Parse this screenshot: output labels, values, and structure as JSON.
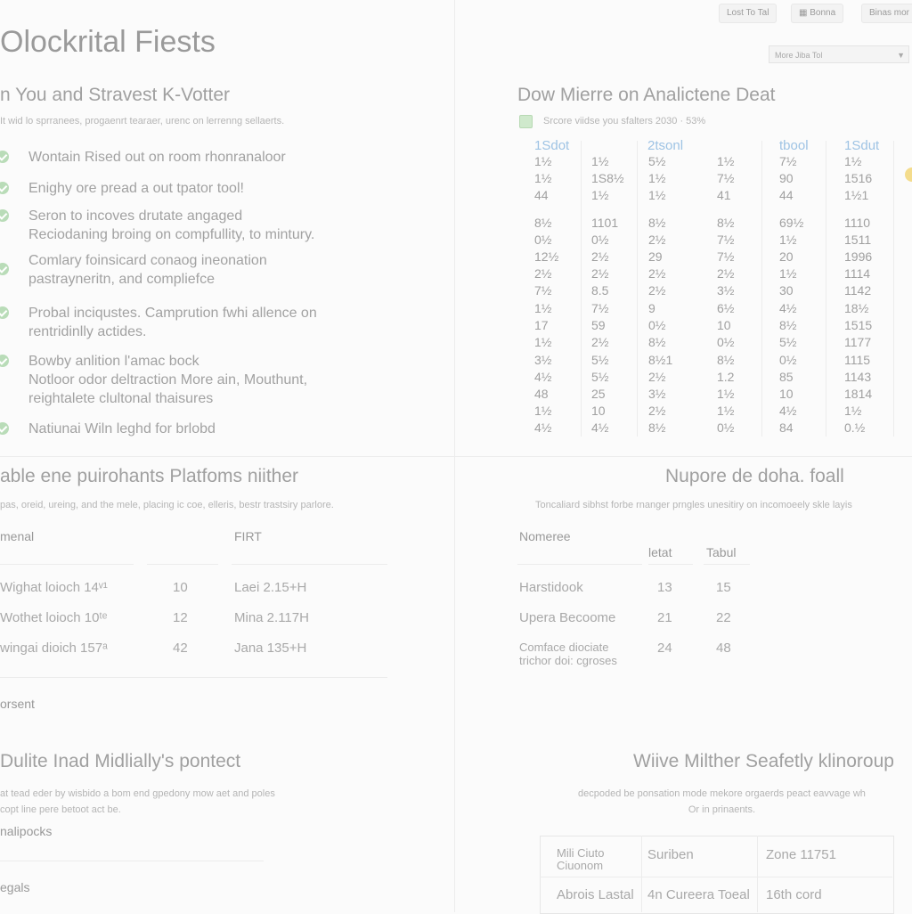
{
  "topbar": {
    "buttons": [
      "Lost To Tal",
      "Bonna",
      "Binas mor"
    ],
    "select_value": "More Jiba Tol"
  },
  "page_title": "Olockrital Fiests",
  "checklist_panel": {
    "title": "n You and Stravest K-Votter",
    "subtitle": "It wid lo sprranees, progaenrt tearaer, urenc on lerrenng sellaerts.",
    "items": [
      "Wontain Rised out on room rhonranaloor",
      "Enighy ore pread a out tpator tool!",
      "Seron to incoves drutate angaged\nReciodaning broing on compfullity, to mintury.",
      "Comlary foinsicard conaog ineonation\npastrayneritn, and compliefce",
      "Probal inciqustes. Camprution fwhi allence on\nrentridinlly actides.",
      "Bowby anlition l'amac bock\nNotloor odor deltraction More ain, Mouthunt,\nreightalete clultonal thaisures",
      "Natiunai Wiln leghd for brlobd"
    ]
  },
  "grid_panel": {
    "title": "Dow Mierre on Analictene Deat",
    "checkbox_label": "Srcore viidse you sfalters  2030 · 53%",
    "columns": [
      "1Sdot",
      "2tsonl",
      "tbool",
      "1Sdut"
    ],
    "rows": [
      [
        "1½",
        "1½",
        "5½",
        "1½",
        "7½",
        "1½"
      ],
      [
        "1½",
        "1S8½",
        "1½",
        "7½",
        "90",
        "1516"
      ],
      [
        "44",
        "1½",
        "1½",
        "41",
        "44",
        "1½1"
      ],
      [
        "8½",
        "1101",
        "8½",
        "8½",
        "69½",
        "1110"
      ],
      [
        "0½",
        "0½",
        "2½",
        "7½",
        "1½",
        "1511"
      ],
      [
        "12½",
        "2½",
        "29",
        "7½",
        "20",
        "1996"
      ],
      [
        "2½",
        "2½",
        "2½",
        "2½",
        "1½",
        "1114"
      ],
      [
        "7½",
        "8.5",
        "2½",
        "3½",
        "30",
        "1142"
      ],
      [
        "1½",
        "7½",
        "9",
        "6½",
        "4½",
        "18½"
      ],
      [
        "17",
        "59",
        "0½",
        "10",
        "8½",
        "1515"
      ],
      [
        "1½",
        "2½",
        "8½",
        "0½",
        "5½",
        "1177"
      ],
      [
        "3½",
        "5½",
        "8½1",
        "8½",
        "0½",
        "1115"
      ],
      [
        "4½",
        "5½",
        "2½",
        "1.2",
        "85",
        "1143"
      ],
      [
        "48",
        "25",
        "3½",
        "1½",
        "10",
        "1814"
      ],
      [
        "1½",
        "10",
        "2½",
        "1½",
        "4½",
        "1½"
      ],
      [
        "4½",
        "4½",
        "8½",
        "0½",
        "84",
        "0.½"
      ]
    ]
  },
  "platform_panel": {
    "title": "able ene puirohants Platfoms niither",
    "subtitle": "pas, oreid, ureing, and the mele, placing ic coe, elleris, bestr trastsiry parlore.",
    "headers": [
      "menal",
      "FIRT"
    ],
    "rows": [
      [
        "Wighat loioch 14ᵛ¹",
        "10",
        "Laei 2.15+H"
      ],
      [
        "Wothet loioch 10ᵗᵉ",
        "12",
        "Mina 2.117H"
      ],
      [
        "wingai dioich 157ᵃ",
        "42",
        "Jana 135+H"
      ]
    ],
    "footer": "orsent"
  },
  "nupore_panel": {
    "title": "Nupore de doha. foall",
    "subtitle": "Toncaliard sibhst forbe rnanger prngles unesitiry on incomoeely skle layis",
    "headers": [
      "Nomeree",
      "letat",
      "Tabul"
    ],
    "rows": [
      [
        "Harstidook",
        "13",
        "15"
      ],
      [
        "Upera Becoome",
        "21",
        "22"
      ],
      [
        "Comface diociate\ntrichor doi: cgroses",
        "24",
        "48"
      ]
    ]
  },
  "midially_panel": {
    "title": "Dulite Inad Midlially's pontect",
    "subtitle": "at tead eder by wisbido a bom end gpedony mow aet and poles\ncopt line pere betoot act be.",
    "label1": "nalipocks",
    "label2": "egals"
  },
  "seafetly_panel": {
    "title": "Wiive Milther Seafetly klinoroup",
    "subtitle": "decpoded be ponsation mode mekore orgaerds peact eavvage wh\nOr in prinaents.",
    "rows": [
      [
        "Mili Ciuto\nCiuonom",
        "Suriben",
        "Zone 11751"
      ],
      [
        "Abrois Lastal",
        "4n Cureera Toeal",
        "16th cord"
      ]
    ]
  }
}
